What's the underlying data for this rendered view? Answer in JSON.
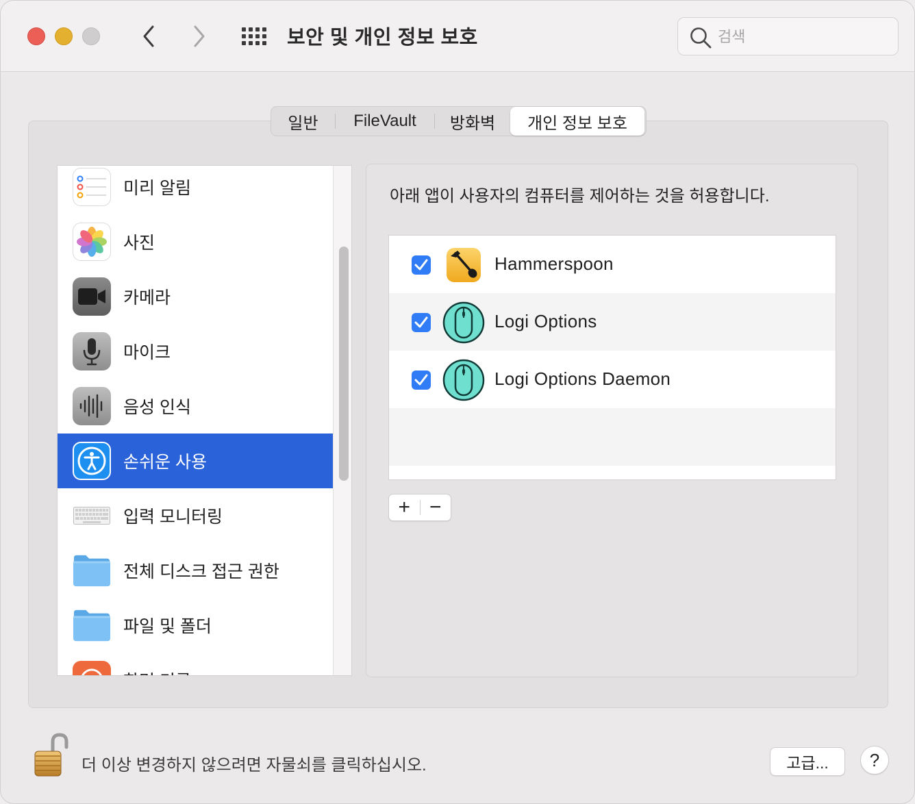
{
  "window": {
    "title": "보안 및 개인 정보 보호"
  },
  "search": {
    "placeholder": "검색",
    "value": ""
  },
  "tabs": [
    {
      "label": "일반",
      "selected": false
    },
    {
      "label": "FileVault",
      "selected": false
    },
    {
      "label": "방화벽",
      "selected": false
    },
    {
      "label": "개인 정보 보호",
      "selected": true
    }
  ],
  "sidebar": {
    "items": [
      {
        "label": "미리 알림",
        "icon": "reminders-icon"
      },
      {
        "label": "사진",
        "icon": "photos-icon"
      },
      {
        "label": "카메라",
        "icon": "camera-icon"
      },
      {
        "label": "마이크",
        "icon": "microphone-icon"
      },
      {
        "label": "음성 인식",
        "icon": "speech-recognition-icon"
      },
      {
        "label": "손쉬운 사용",
        "icon": "accessibility-icon",
        "selected": true
      },
      {
        "label": "입력 모니터링",
        "icon": "keyboard-icon"
      },
      {
        "label": "전체 디스크 접근 권한",
        "icon": "folder-icon"
      },
      {
        "label": "파일 및 폴더",
        "icon": "folder-icon"
      },
      {
        "label": "화면 기록",
        "icon": "screen-recording-icon"
      }
    ]
  },
  "main": {
    "description": "아래 앱이 사용자의 컴퓨터를 제어하는 것을 허용합니다.",
    "apps": [
      {
        "name": "Hammerspoon",
        "checked": true,
        "icon": "hammerspoon-icon"
      },
      {
        "name": "Logi Options",
        "checked": true,
        "icon": "logi-mouse-icon"
      },
      {
        "name": "Logi Options Daemon",
        "checked": true,
        "icon": "logi-mouse-icon"
      }
    ],
    "add_label": "+",
    "remove_label": "−"
  },
  "footer": {
    "lock_text": "더 이상 변경하지 않으려면 자물쇠를 클릭하십시오.",
    "advanced_label": "고급...",
    "help_label": "?"
  },
  "colors": {
    "selection": "#2a62d9",
    "checkbox": "#2f7cf6",
    "close": "#ec5f57",
    "minimize": "#e4b02f"
  }
}
